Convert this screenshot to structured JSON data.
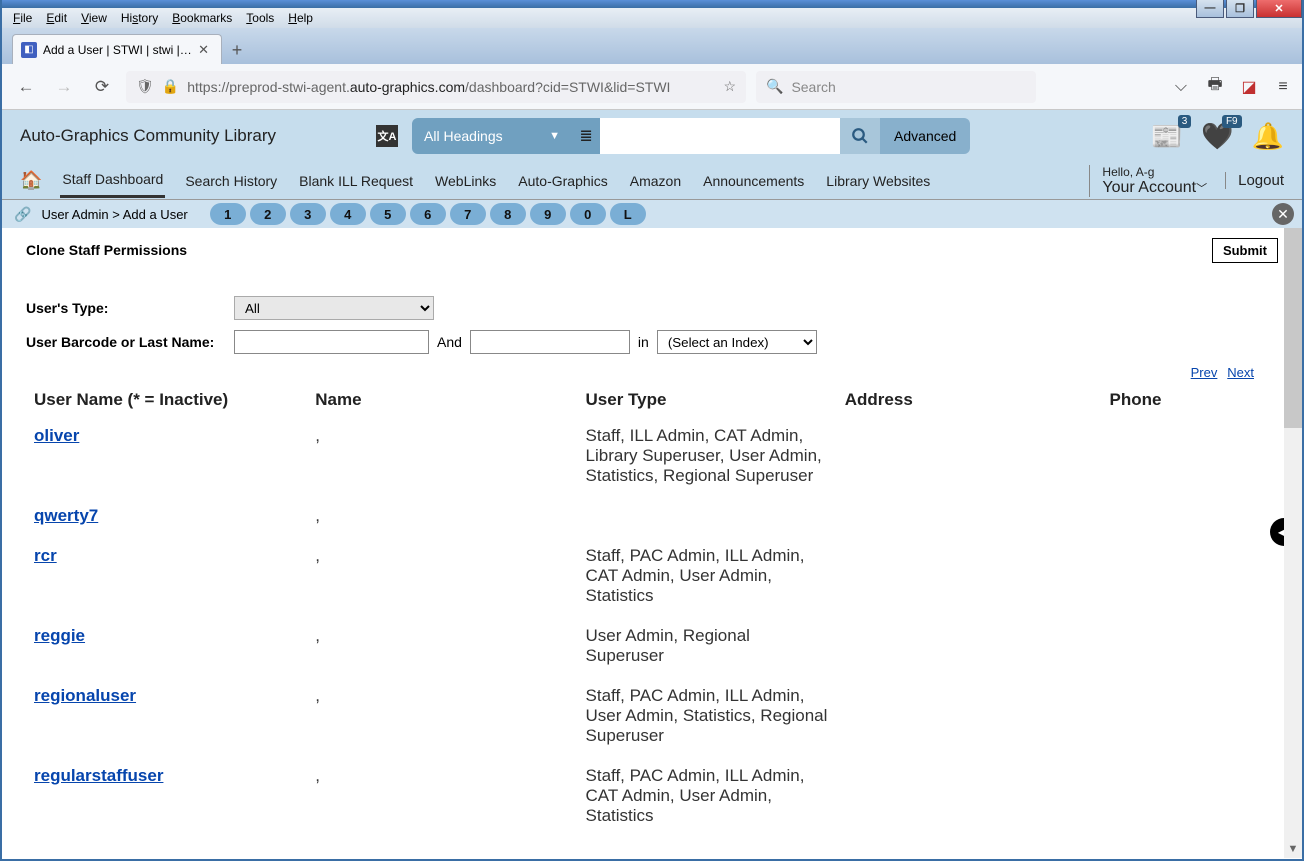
{
  "browser": {
    "menubar": [
      "File",
      "Edit",
      "View",
      "History",
      "Bookmarks",
      "Tools",
      "Help"
    ],
    "tab_title": "Add a User | STWI | stwi | Auto-G",
    "url_prefix": "https://preprod-stwi-agent.",
    "url_bold": "auto-graphics.com",
    "url_suffix": "/dashboard?cid=STWI&lid=STWI",
    "search_placeholder": "Search"
  },
  "app": {
    "library_name": "Auto-Graphics Community Library",
    "scope": "All Headings",
    "advanced": "Advanced",
    "badge1": "3",
    "badge2": "F9",
    "hello": "Hello, A-g",
    "your_account": "Your Account",
    "logout": "Logout",
    "nav": [
      "Staff Dashboard",
      "Search History",
      "Blank ILL Request",
      "WebLinks",
      "Auto-Graphics",
      "Amazon",
      "Announcements",
      "Library Websites"
    ],
    "breadcrumb": "User Admin > Add a User",
    "pills": [
      "1",
      "2",
      "3",
      "4",
      "5",
      "6",
      "7",
      "8",
      "9",
      "0",
      "L"
    ]
  },
  "content": {
    "title": "Clone Staff Permissions",
    "submit": "Submit",
    "users_type_label": "User's Type:",
    "users_type_value": "All",
    "barcode_label": "User Barcode or Last Name:",
    "and": "And",
    "in": "in",
    "index_placeholder": "(Select an Index)",
    "prev": "Prev",
    "next": "Next",
    "columns": {
      "username": "User Name (* = Inactive)",
      "name": "Name",
      "usertype": "User Type",
      "address": "Address",
      "phone": "Phone"
    },
    "rows": [
      {
        "username": "oliver",
        "name": ",",
        "usertype": "Staff, ILL Admin, CAT Admin, Library Superuser, User Admin, Statistics, Regional Superuser",
        "address": "",
        "phone": ""
      },
      {
        "username": "qwerty7",
        "name": ",",
        "usertype": "",
        "address": "",
        "phone": ""
      },
      {
        "username": "rcr",
        "name": ",",
        "usertype": "Staff, PAC Admin, ILL Admin, CAT Admin, User Admin, Statistics",
        "address": "",
        "phone": ""
      },
      {
        "username": "reggie",
        "name": ",",
        "usertype": "User Admin, Regional Superuser",
        "address": "",
        "phone": ""
      },
      {
        "username": "regionaluser",
        "name": ",",
        "usertype": "Staff, PAC Admin, ILL Admin, User Admin, Statistics, Regional Superuser",
        "address": "",
        "phone": ""
      },
      {
        "username": "regularstaffuser",
        "name": ",",
        "usertype": "Staff, PAC Admin, ILL Admin, CAT Admin, User Admin, Statistics",
        "address": "",
        "phone": ""
      }
    ]
  }
}
